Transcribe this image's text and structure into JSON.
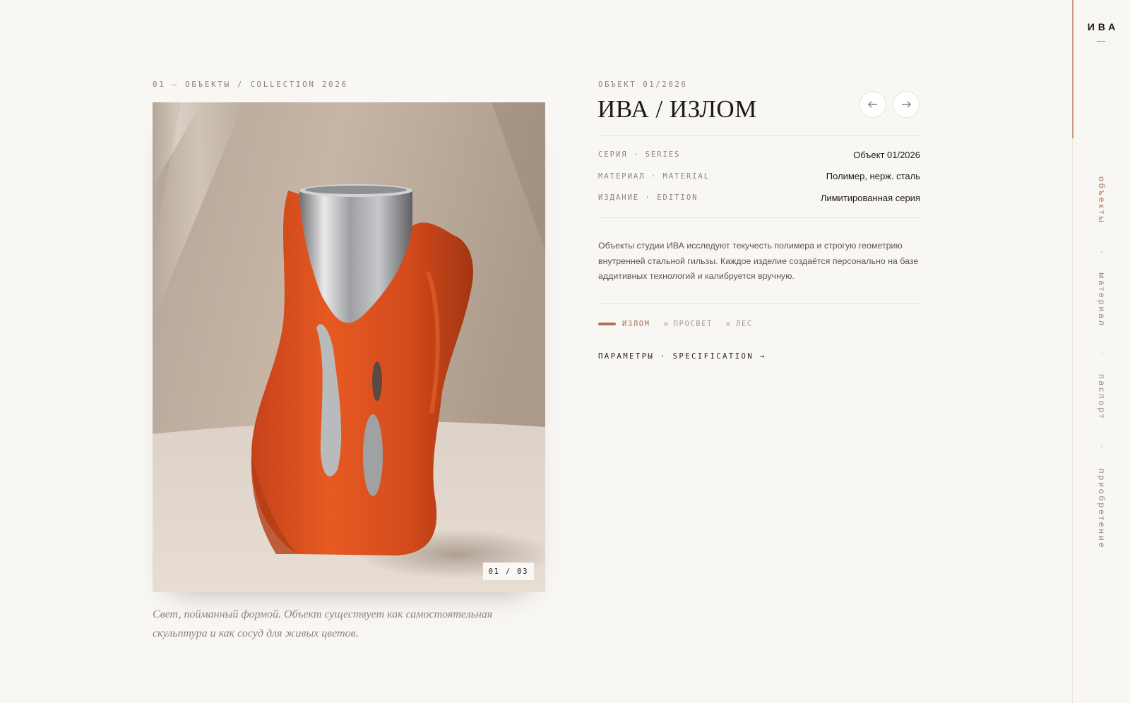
{
  "left": {
    "kicker": "01 — ОБЪЕКТЫ / COLLECTION 2026",
    "counter": "01 / 03",
    "caption": "Свет, пойманный формой. Объект существует как самостоятельная скульптура и как сосуд для живых цветов."
  },
  "product": {
    "meta": "ОБЪЕКТ 01/2026",
    "title": "ИВА / ИЗЛОМ",
    "specs": [
      {
        "key": "СЕРИЯ · SERIES",
        "value": "Объект 01/2026"
      },
      {
        "key": "МАТЕРИАЛ · MATERIAL",
        "value": "Полимер, нерж. сталь"
      },
      {
        "key": "ИЗДАНИЕ · EDITION",
        "value": "Лимитированная серия"
      }
    ],
    "description": "Объекты студии ИВА исследуют текучесть полимера и строгую геометрию внутренней стальной гильзы. Каждое изделие создаётся персонально на базе аддитивных технологий и калибруется вручную.",
    "variants": [
      {
        "label": "ИЗЛОМ",
        "active": true
      },
      {
        "label": "ПРОСВЕТ",
        "active": false
      },
      {
        "label": "ЛЕС",
        "active": false
      }
    ],
    "spec_link": "ПАРАМЕТРЫ · SPECIFICATION →"
  },
  "sidebar": {
    "logo": "ИВА",
    "items": [
      {
        "label": "объекты",
        "active": true
      },
      {
        "label": "материал",
        "active": false
      },
      {
        "label": "паспорт",
        "active": false
      },
      {
        "label": "приобретение",
        "active": false
      }
    ]
  },
  "icons": {
    "prev": "arrow-left-icon",
    "next": "arrow-right-icon"
  },
  "colors": {
    "background": "#f9f7f4",
    "accent": "#b0705a",
    "polymer_orange": "#d9511f",
    "steel": "#a7a9ab"
  }
}
